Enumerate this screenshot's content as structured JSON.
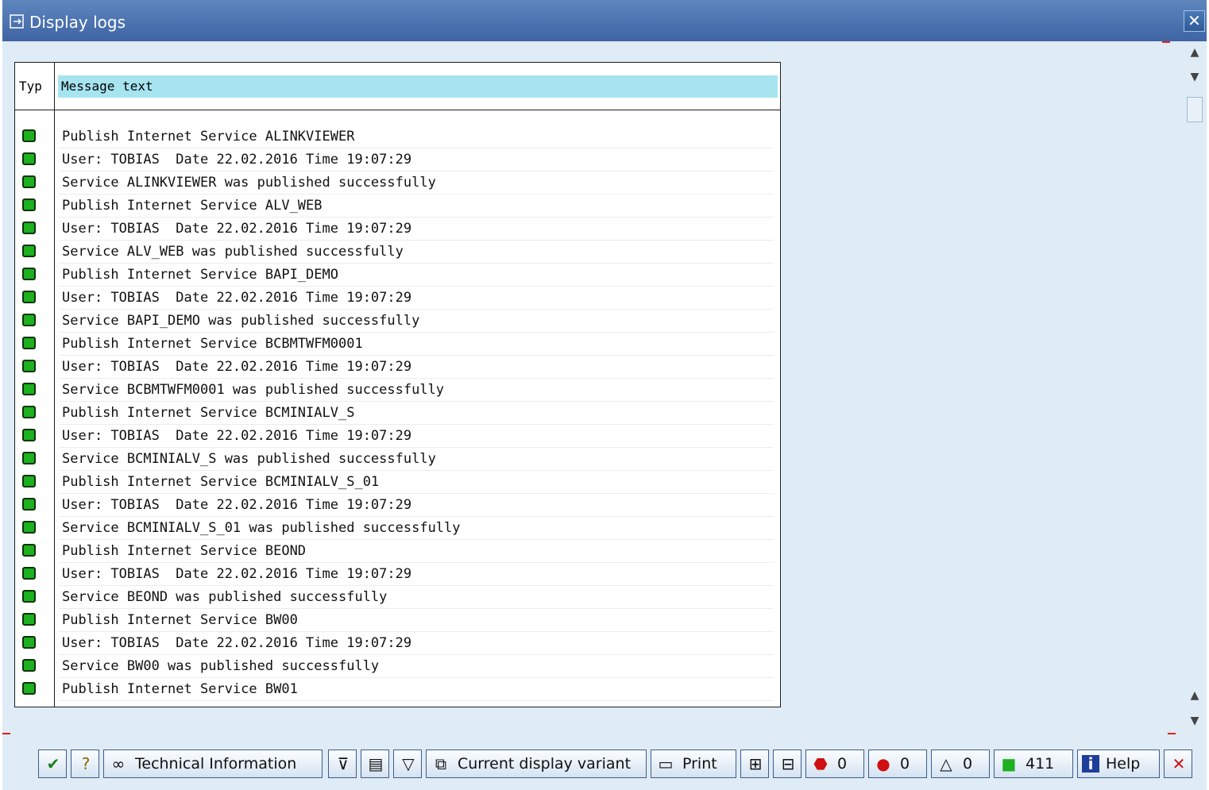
{
  "window": {
    "title": "Display logs",
    "close_label": "✕"
  },
  "table": {
    "header_typ": "Typ",
    "header_message": "Message text",
    "rows": [
      "Publish Internet Service ALINKVIEWER",
      "User: TOBIAS  Date 22.02.2016 Time 19:07:29",
      "Service ALINKVIEWER was published successfully",
      "Publish Internet Service ALV_WEB",
      "User: TOBIAS  Date 22.02.2016 Time 19:07:29",
      "Service ALV_WEB was published successfully",
      "Publish Internet Service BAPI_DEMO",
      "User: TOBIAS  Date 22.02.2016 Time 19:07:29",
      "Service BAPI_DEMO was published successfully",
      "Publish Internet Service BCBMTWFM0001",
      "User: TOBIAS  Date 22.02.2016 Time 19:07:29",
      "Service BCBMTWFM0001 was published successfully",
      "Publish Internet Service BCMINIALV_S",
      "User: TOBIAS  Date 22.02.2016 Time 19:07:29",
      "Service BCMINIALV_S was published successfully",
      "Publish Internet Service BCMINIALV_S_01",
      "User: TOBIAS  Date 22.02.2016 Time 19:07:29",
      "Service BCMINIALV_S_01 was published successfully",
      "Publish Internet Service BEOND",
      "User: TOBIAS  Date 22.02.2016 Time 19:07:29",
      "Service BEOND was published successfully",
      "Publish Internet Service BW00",
      "User: TOBIAS  Date 22.02.2016 Time 19:07:29",
      "Service BW00 was published successfully",
      "Publish Internet Service BW01"
    ]
  },
  "toolbar": {
    "technical_information": "Technical Information",
    "current_display_variant": "Current display variant",
    "print": "Print",
    "error_count": "0",
    "abort_count": "0",
    "warning_count": "0",
    "success_count": "411",
    "help": "Help"
  },
  "colors": {
    "header_bg": "#a6e4f0",
    "success_led": "#1db01f",
    "window_bg": "#dfebf5"
  }
}
